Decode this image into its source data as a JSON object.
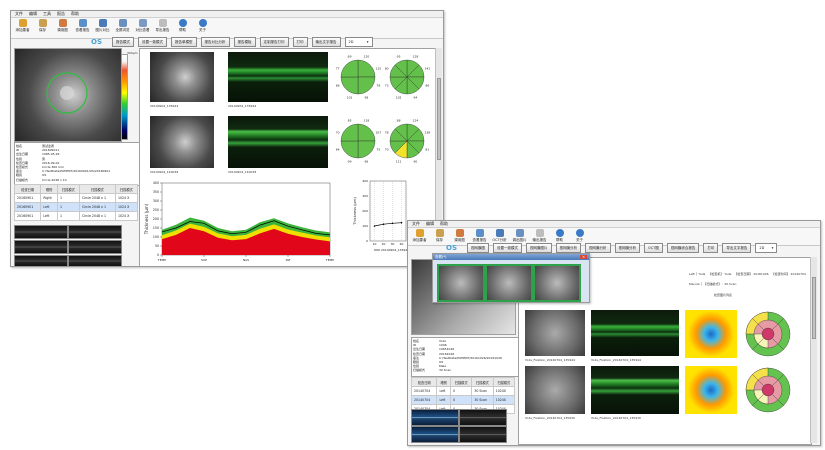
{
  "win1": {
    "menu": [
      "文件",
      "编辑",
      "工具",
      "报告",
      "帮助"
    ],
    "toolbar": [
      "添加患者",
      "保存",
      "调用图",
      "查看报告",
      "图片对比",
      "全屏浏览",
      "对比查看",
      "导出报告",
      "帮助",
      "关于"
    ],
    "eye": "OS",
    "buttons": [
      "报告模式",
      "设置一致模式",
      "报告单模型",
      "报告对比分析",
      "报告模板",
      "定制报告打印",
      "打印",
      "输出文字报告"
    ],
    "dropdown": "2D",
    "cmap_label": "300μm",
    "patient": [
      [
        "姓名",
        "",
        "测试患者"
      ],
      [
        "ID",
        "",
        "201609011"
      ],
      [
        "出生日期",
        "",
        "1985-05-26"
      ],
      [
        "性别",
        "",
        "男"
      ],
      [
        "检查日期",
        "",
        "2016-09-01"
      ],
      [
        "检查模式",
        "",
        "Circle 360 mm"
      ],
      [
        "备注",
        "",
        "C:/TestData/PATIENT/20160901/OS/20160901"
      ],
      [
        "眼别",
        "",
        "OS"
      ],
      [
        "扫描模式",
        "",
        "Circle 2048 x 10"
      ]
    ],
    "table": {
      "headers": [
        "检查日期",
        "眼别",
        "扫描模式",
        "扫描模式",
        "扫描模式"
      ],
      "rows": [
        [
          "20160901",
          "Right",
          "1",
          "Circle 2048 x 1",
          "1024 X"
        ],
        [
          "20160901",
          "Left",
          "1",
          "Circle 2048 x 1",
          "1024 X"
        ],
        [
          "20160901",
          "Left",
          "1",
          "Circle 2048 x 1",
          "1024 X"
        ]
      ]
    },
    "img_caption_1": "20140904_135944",
    "oct_caption_1": "20140904_135944",
    "img_caption_2": "20140904_140038",
    "oct_caption_2": "20140904_140038",
    "sector_values_a": [
      "120",
      "115",
      "78",
      "98",
      "101",
      "66",
      "77",
      "89"
    ],
    "sector_values_b": [
      "128",
      "141",
      "86",
      "94",
      "102",
      "73",
      "80",
      "95"
    ],
    "sector_values_c": [
      "118",
      "107",
      "75",
      "96",
      "99",
      "64",
      "70",
      "85"
    ],
    "sector_values_d": [
      "124",
      "138",
      "81",
      "90",
      "111",
      "70",
      "78",
      "88"
    ]
  },
  "chart_data": [
    {
      "type": "area",
      "title": "",
      "xlabel": "",
      "ylabel": "Thickness (μm)",
      "ylim": [
        0,
        400
      ],
      "yticks": [
        0,
        50,
        100,
        150,
        200,
        250,
        300,
        350,
        400
      ],
      "xticks": [
        "TEMP",
        "SUP",
        "NAS",
        "INF",
        "TEMP"
      ],
      "x": [
        0,
        16,
        32,
        48,
        64,
        80,
        96,
        112,
        128,
        144,
        160,
        176,
        192
      ],
      "series": [
        {
          "values": [
            88,
            112,
            150,
            132,
            96,
            82,
            88,
            120,
            145,
            118,
            100,
            86,
            76
          ],
          "color": "#e2061a"
        },
        {
          "values": [
            110,
            136,
            174,
            156,
            120,
            104,
            112,
            146,
            170,
            142,
            124,
            108,
            98
          ],
          "color": "#f0e000"
        },
        {
          "values": [
            140,
            168,
            208,
            190,
            150,
            132,
            140,
            182,
            204,
            176,
            154,
            136,
            126
          ],
          "color": "#3cb43c"
        },
        {
          "values": [
            128,
            150,
            186,
            176,
            134,
            118,
            126,
            166,
            190,
            160,
            140,
            120,
            112
          ],
          "color": "#000000"
        }
      ]
    },
    {
      "type": "line",
      "ylabel": "Thickness (μm)",
      "ylim": [
        0,
        400
      ],
      "xticks": [
        "10",
        "20",
        "30",
        "40"
      ],
      "legend": "20140904_135944",
      "series": [
        {
          "x": [
            10,
            20,
            30,
            40
          ],
          "values": [
            100,
            112,
            118,
            122
          ],
          "color": "#000000"
        }
      ]
    }
  ],
  "win2": {
    "menu": [
      "文件",
      "编辑",
      "帮助"
    ],
    "toolbar": [
      "添加患者",
      "保存",
      "调用图",
      "查看报告",
      "OCT分析",
      "调出图片",
      "输出报告",
      "帮助",
      "关于"
    ],
    "eye": "OS",
    "buttons": [
      "视网膜图",
      "设置一致模式",
      "视网膜图片",
      "视网膜分析",
      "视网膜分析",
      "视网膜分析",
      "OCT图",
      "视网膜综合报告",
      "打印",
      "导出文字报告"
    ],
    "dropdown": "2D",
    "popup_title": "查看(*)",
    "info_line1": [
      "Left  │  Yoda",
      "【检查机】 Yoda",
      "【检查日期】 20161026",
      "【检查时间】 20140704"
    ],
    "info_line2": [
      "Macula  │  【扫描模式】 : 30 Scan"
    ],
    "info_line3": "检查图片列表",
    "patient": [
      [
        "姓名",
        "",
        "Yoda"
      ],
      [
        "ID",
        "",
        "1006"
      ],
      [
        "出生日期",
        "",
        "19651026"
      ],
      [
        "检查日期",
        "",
        "20161026"
      ],
      [
        "备注",
        "",
        "C:/TestData/PATIENT/20161026/20161026"
      ],
      [
        "眼别",
        "",
        "OS"
      ],
      [
        "性别",
        "",
        "Male"
      ],
      [
        "扫描模式",
        "",
        "30 Scan"
      ]
    ],
    "table": {
      "headers": [
        "检查日期",
        "眼别",
        "扫描模式",
        "扫描模式",
        "扫描模式"
      ],
      "rows": [
        [
          "20140704",
          "Left",
          "0",
          "30 Scan",
          "1024X"
        ],
        [
          "20140704",
          "Left",
          "0",
          "30 Scan",
          "1024X"
        ],
        [
          "20140704",
          "Left",
          "0",
          "30 Scan",
          "1024X"
        ]
      ]
    },
    "img_caption_1": "Yoda_Fixation_20140704_135944",
    "oct_caption_1": "Yoda_Fixation_20140704_135944",
    "img_caption_2": "Yoda_Fixation_20140704_135930",
    "oct_caption_2": "Yoda_Fixation_20140704_135930"
  }
}
